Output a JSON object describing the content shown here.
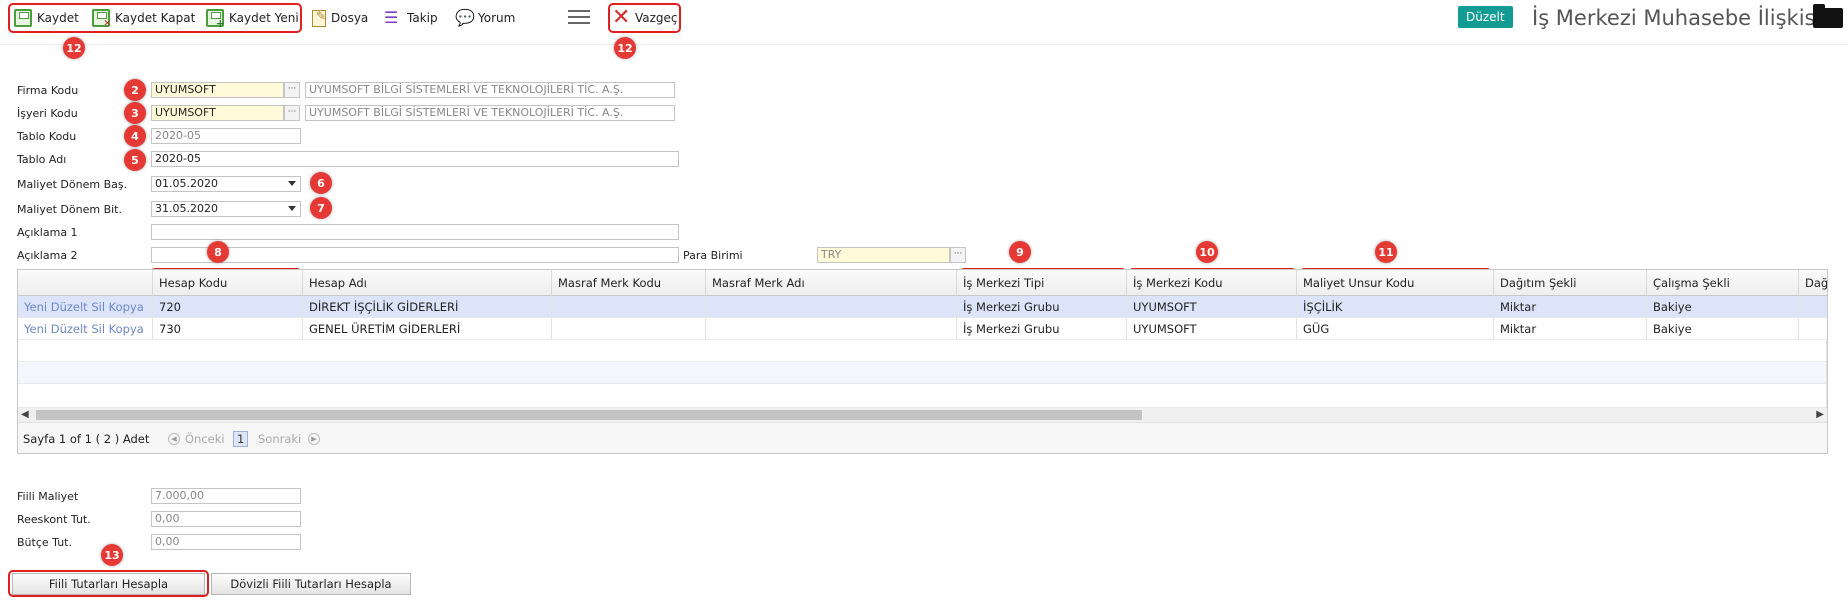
{
  "toolbar": {
    "save": "Kaydet",
    "save_close": "Kaydet Kapat",
    "save_new": "Kaydet Yeni",
    "file": "Dosya",
    "follow": "Takip",
    "comment": "Yorum",
    "cancel": "Vazgeç",
    "mode_badge": "Düzelt",
    "page_title": "İş Merkezi Muhasebe İlişkisi"
  },
  "markers": [
    "12",
    "12",
    "2",
    "3",
    "4",
    "5",
    "6",
    "7",
    "8",
    "9",
    "10",
    "11",
    "13"
  ],
  "form": {
    "firma_label": "Firma Kodu",
    "firma_value": "UYUMSOFT",
    "firma_desc": "UYUMSOFT BİLGİ SİSTEMLERİ VE TEKNOLOJİLERİ TİC. A.Ş.",
    "isyeri_label": "İşyeri Kodu",
    "isyeri_value": "UYUMSOFT",
    "isyeri_desc": "UYUMSOFT BİLGİ SİSTEMLERİ VE TEKNOLOJİLERİ TİC. A.Ş.",
    "tablo_kodu_label": "Tablo Kodu",
    "tablo_kodu_value": "2020-05",
    "tablo_adi_label": "Tablo Adı",
    "tablo_adi_value": "2020-05",
    "donem_bas_label": "Maliyet Dönem Baş.",
    "donem_bas_value": "01.05.2020",
    "donem_bit_label": "Maliyet Dönem Bit.",
    "donem_bit_value": "31.05.2020",
    "aciklama1_label": "Açıklama 1",
    "aciklama1_value": "",
    "aciklama2_label": "Açıklama 2",
    "aciklama2_value": "",
    "para_birimi_label": "Para Birimi",
    "para_birimi_value": "TRY"
  },
  "grid": {
    "columns": [
      "",
      "Hesap Kodu",
      "Hesap Adı",
      "Masraf Merk Kodu",
      "Masraf Merk Adı",
      "İş Merkezi Tipi",
      "İş Merkezi Kodu",
      "Maliyet Unsur Kodu",
      "Dağıtım Şekli",
      "Çalışma Şekli",
      "Dağ"
    ],
    "rows": [
      [
        "Yeni Düzelt Sil Kopya",
        "720",
        "DİREKT İŞÇİLİK GİDERLERİ",
        "",
        "",
        "İş Merkezi Grubu",
        "UYUMSOFT",
        "İŞÇİLİK",
        "Miktar",
        "Bakiye",
        ""
      ],
      [
        "Yeni Düzelt Sil Kopya",
        "730",
        "GENEL ÜRETİM GİDERLERİ",
        "",
        "",
        "İş Merkezi Grubu",
        "UYUMSOFT",
        "GÜG",
        "Miktar",
        "Bakiye",
        ""
      ]
    ],
    "pager": {
      "info": "Sayfa 1 of 1 ( 2 ) Adet",
      "prev": "Önceki",
      "page": "1",
      "next": "Sonraki"
    }
  },
  "totals": {
    "fiili_label": "Fiili Maliyet",
    "fiili_value": "7.000,00",
    "reeskont_label": "Reeskont Tut.",
    "reeskont_value": "0,00",
    "butce_label": "Bütçe Tut.",
    "butce_value": "0,00"
  },
  "buttons": {
    "calc": "Fiili Tutarları Hesapla",
    "calc_fx": "Dövizli Fiili Tutarları Hesapla"
  }
}
